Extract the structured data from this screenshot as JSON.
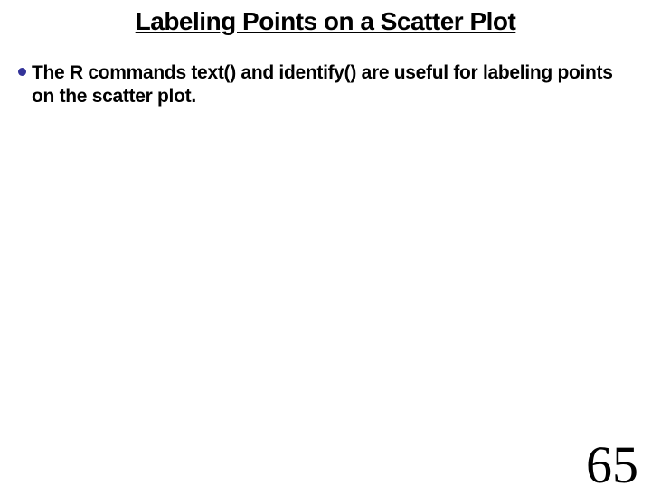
{
  "title": "Labeling Points on a Scatter Plot",
  "bullet_text": "The R commands text() and identify() are useful for labeling points on the scatter plot.",
  "page_number": "65"
}
